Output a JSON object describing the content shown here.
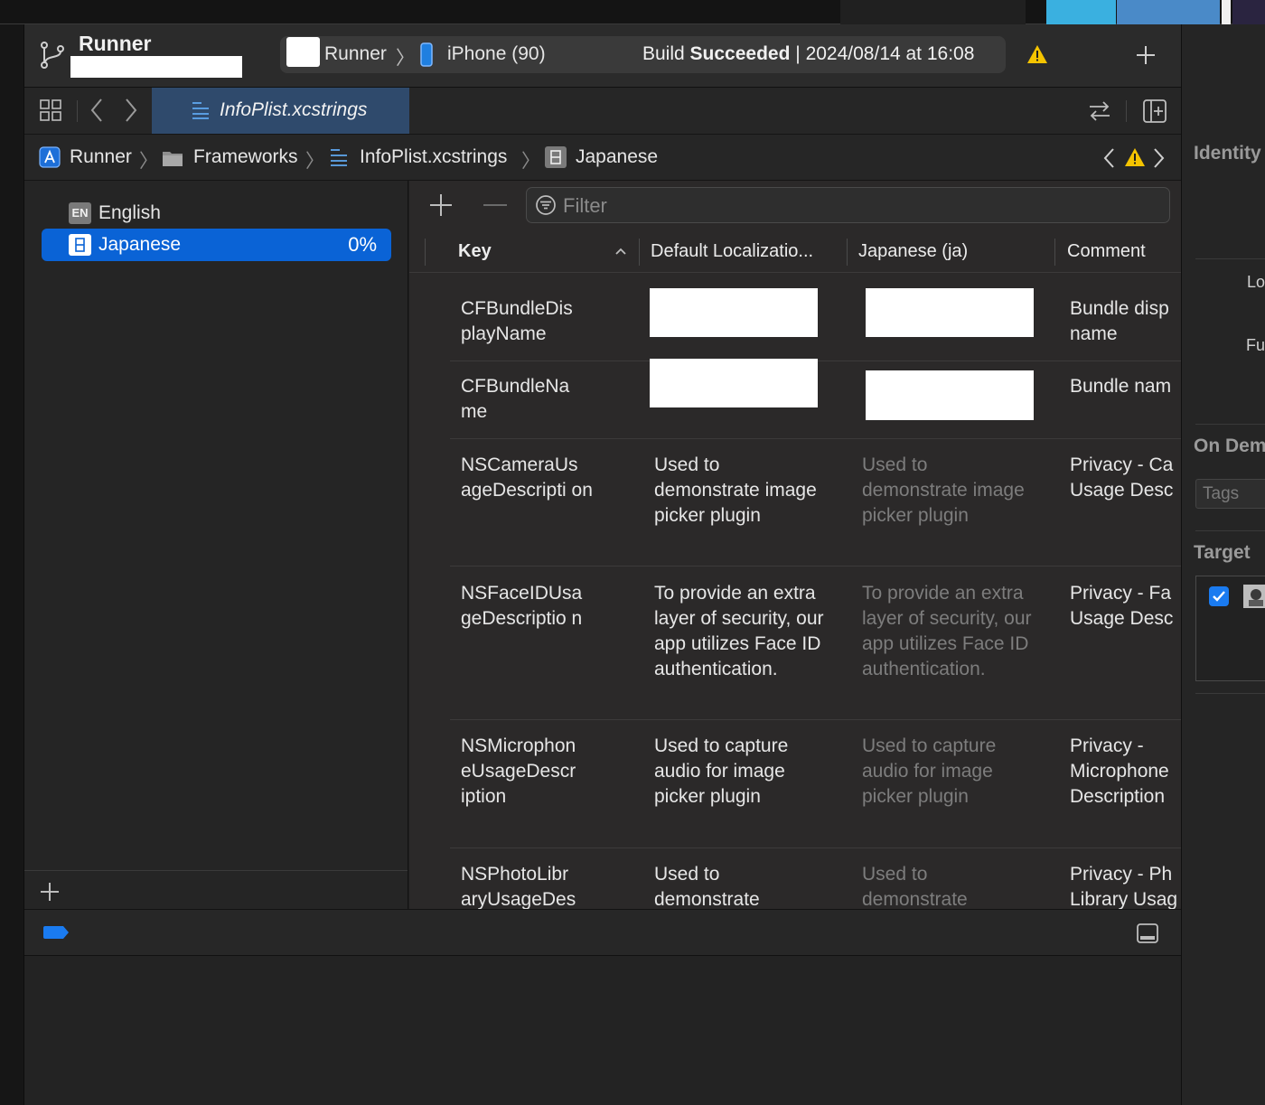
{
  "toolbar": {
    "project_name": "Runner",
    "scheme": "Runner",
    "device": "iPhone (90)",
    "status_prefix": "Build",
    "status_bold": "Succeeded",
    "status_suffix": "| 2024/08/14 at 16:08"
  },
  "tab": {
    "filename": "InfoPlist.xcstrings"
  },
  "breadcrumb": {
    "items": [
      "Runner",
      "Frameworks",
      "InfoPlist.xcstrings",
      "Japanese"
    ]
  },
  "sidebar": {
    "languages": [
      {
        "badge": "EN",
        "label": "English",
        "progress": "",
        "selected": false
      },
      {
        "badge": "",
        "label": "Japanese",
        "progress": "0%",
        "selected": true
      }
    ]
  },
  "editor": {
    "filter_placeholder": "Filter",
    "columns": [
      "Key",
      "Default Localizatio...",
      "Japanese (ja)",
      "Comment"
    ],
    "rows": [
      {
        "key": "CFBundleDis playName",
        "default": "",
        "japanese": "",
        "comment": "Bundle disp name"
      },
      {
        "key": "CFBundleNa me",
        "default": "",
        "japanese": "",
        "comment": "Bundle nam"
      },
      {
        "key": "NSCameraUs ageDescripti on",
        "default": "Used to demonstrate image picker plugin",
        "japanese": "Used to demonstrate image picker plugin",
        "comment": "Privacy - Ca Usage Desc"
      },
      {
        "key": "NSFaceIDUsa geDescriptio n",
        "default": "To provide an extra layer of security, our app utilizes Face ID authentication.",
        "japanese": "To provide an extra layer of security, our app utilizes Face ID authentication.",
        "comment": "Privacy - Fa Usage Desc"
      },
      {
        "key": "NSMicrophon eUsageDescr iption",
        "default": "Used to capture audio for image picker plugin",
        "japanese": "Used to capture audio for image picker plugin",
        "comment": "Privacy - Microphone Description"
      },
      {
        "key": "NSPhotoLibr aryUsageDes",
        "default": "Used to demonstrate",
        "japanese": "Used to demonstrate",
        "comment": "Privacy - Ph Library Usag"
      }
    ]
  },
  "inspector": {
    "identity_heading": "Identity",
    "lo_label": "Lo",
    "fu_label": "Fu",
    "on_demand_heading": "On Dem",
    "tags_placeholder": "Tags",
    "target_heading": "Target"
  },
  "colors": {
    "accent": "#0a63d6",
    "warning": "#f5c400",
    "tab_active": "#2f4a6c",
    "window_bg": "#1f1f1f"
  }
}
